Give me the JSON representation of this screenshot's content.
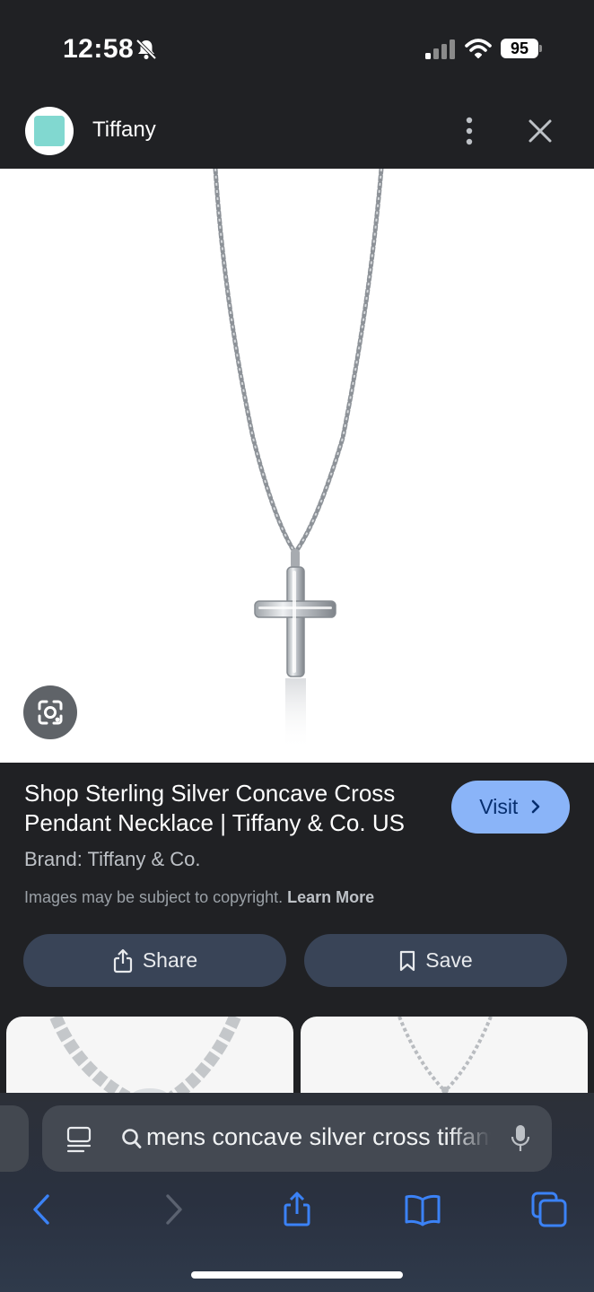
{
  "status_bar": {
    "time": "12:58",
    "battery": "95",
    "icons": [
      "bell-slash-icon",
      "cellular-signal-icon",
      "wifi-icon",
      "battery-icon"
    ]
  },
  "header": {
    "source_name": "Tiffany",
    "favicon_color": "#81d8d0",
    "icons": [
      "more-vertical-icon",
      "close-icon"
    ]
  },
  "result": {
    "title": "Shop Sterling Silver Concave Cross Pendant Necklace | Tiffany & Co. US",
    "visit_label": "Visit",
    "brand": "Brand: Tiffany & Co.",
    "copyright_notice": "Images may be subject to copyright.",
    "learn_more": "Learn More",
    "share_label": "Share",
    "save_label": "Save"
  },
  "browser": {
    "address_text": "mens concave silver cross tiffany",
    "icons": [
      "reader-icon",
      "search-icon",
      "microphone-icon",
      "back-icon",
      "forward-icon",
      "share-icon",
      "bookmarks-icon",
      "tabs-icon"
    ]
  },
  "colors": {
    "background": "#202124",
    "visit_button": "#8ab4f8",
    "action_button": "#394457",
    "safari_accent": "#3b82f6"
  }
}
